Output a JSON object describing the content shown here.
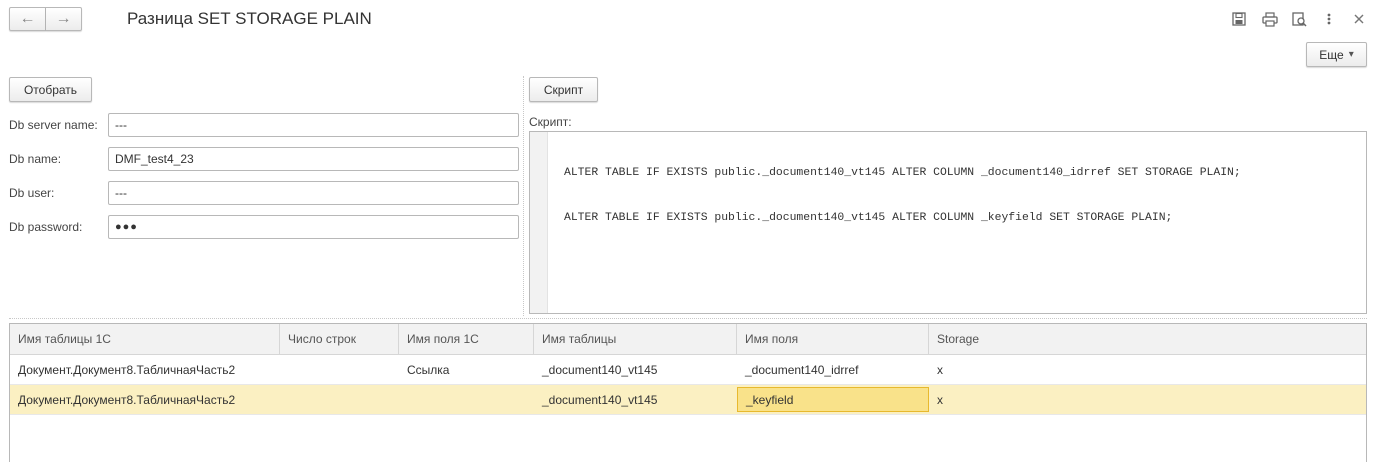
{
  "window": {
    "title": "Разница SET STORAGE PLAIN",
    "nav": {
      "back_icon": "←",
      "forward_icon": "→"
    },
    "icons": [
      "save-icon",
      "print-icon",
      "preview-icon",
      "more-vertical-icon",
      "close-icon"
    ],
    "more_label": "Еще",
    "more_arrow": "▾"
  },
  "left": {
    "select_button": "Отобрать",
    "fields": [
      {
        "label": "Db server name:",
        "value": "---"
      },
      {
        "label": "Db name:",
        "value": "DMF_test4_23"
      },
      {
        "label": "Db user:",
        "value": "---"
      },
      {
        "label": "Db password:",
        "value": "●●●"
      }
    ]
  },
  "right": {
    "script_button": "Скрипт",
    "script_label": "Скрипт:",
    "script_lines": [
      "ALTER TABLE IF EXISTS public._document140_vt145 ALTER COLUMN _document140_idrref SET STORAGE PLAIN;",
      "ALTER TABLE IF EXISTS public._document140_vt145 ALTER COLUMN _keyfield SET STORAGE PLAIN;"
    ]
  },
  "table": {
    "columns": [
      "Имя таблицы 1С",
      "Число строк",
      "Имя поля 1С",
      "Имя таблицы",
      "Имя поля",
      "Storage"
    ],
    "rows": [
      [
        "Документ.Документ8.ТабличнаяЧасть2",
        "",
        "Ссылка",
        "_document140_vt145",
        "_document140_idrref",
        "x"
      ],
      [
        "Документ.Документ8.ТабличнаяЧасть2",
        "",
        "",
        "_document140_vt145",
        "_keyfield",
        "x"
      ]
    ]
  },
  "colors": {
    "selected_row": "#fbf0c2",
    "current_cell": "#f9e28a",
    "current_cell_border": "#e8b92e"
  }
}
